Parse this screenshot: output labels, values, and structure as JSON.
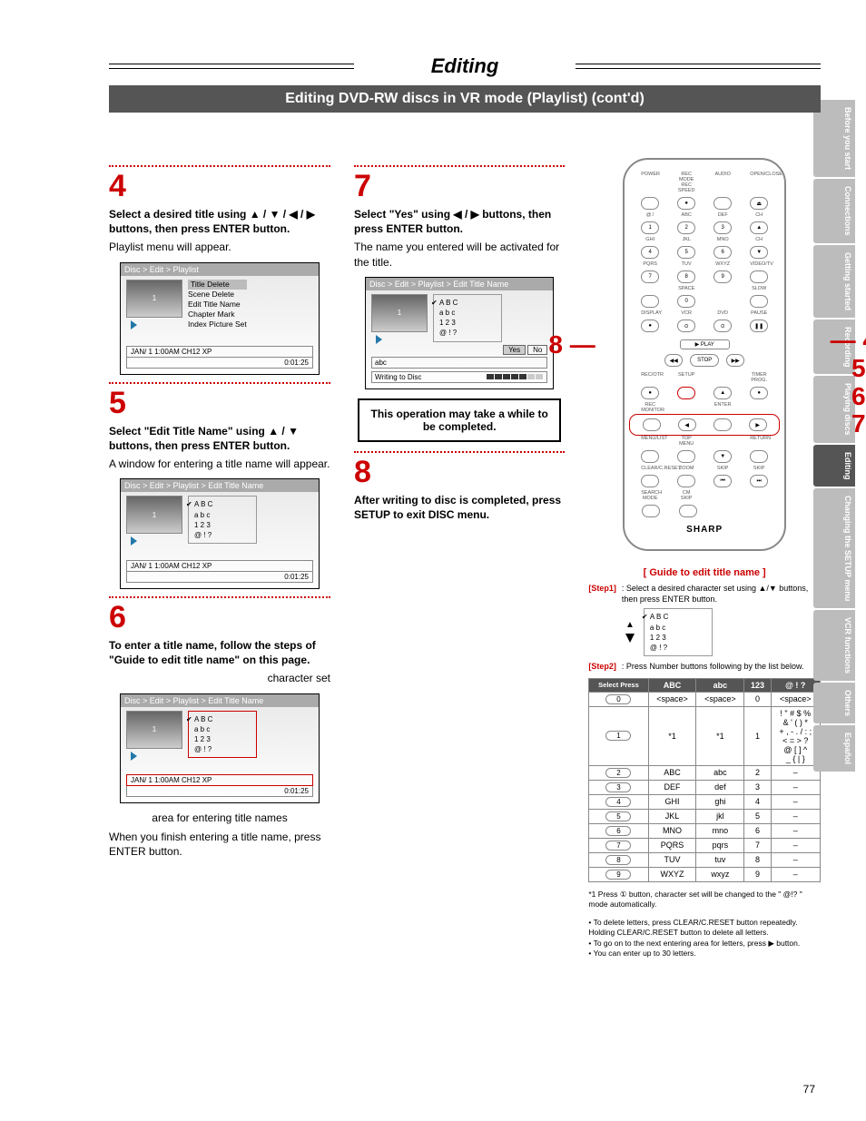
{
  "header": {
    "title": "Editing",
    "subtitle": "Editing DVD-RW discs in VR mode (Playlist) (cont'd)"
  },
  "steps": {
    "s4": {
      "num": "4",
      "head": "Select a desired title using ▲ / ▼ / ◀ / ▶ buttons, then press ENTER button.",
      "body": "Playlist menu will appear.",
      "breadcrumb": "Disc > Edit > Playlist",
      "menu": {
        "hl": "Title Delete",
        "items": [
          "Scene Delete",
          "Edit Title Name",
          "Chapter Mark",
          "Index Picture Set"
        ]
      },
      "status_left": "JAN/ 1   1:00AM  CH12     XP",
      "status_right": "0:01:25"
    },
    "s5": {
      "num": "5",
      "head": "Select \"Edit Title Name\" using ▲ / ▼ buttons, then press ENTER button.",
      "body": "A window for entering a title name will appear.",
      "breadcrumb": "Disc > Edit > Playlist > Edit Title Name",
      "charset": {
        "sel": "A B C",
        "rows": [
          "a b c",
          "1 2 3",
          "@ ! ?"
        ]
      },
      "status_left": "JAN/ 1   1:00AM  CH12  XP",
      "status_right": "0:01:25"
    },
    "s6": {
      "num": "6",
      "head": "To enter a title name, follow the steps of \"Guide to edit title name\" on this page.",
      "label_top": "character set",
      "breadcrumb": "Disc > Edit  > Playlist > Edit Title Name",
      "charset": {
        "sel": "A B C",
        "rows": [
          "a b c",
          "1 2 3",
          "@ ! ?"
        ]
      },
      "label_bottom": "area for entering title names",
      "status_left": "JAN/ 1   1:00AM  CH12  XP",
      "status_right": "0:01:25",
      "after": "When you finish entering a title name, press ENTER button."
    },
    "s7": {
      "num": "7",
      "head": "Select \"Yes\" using ◀ / ▶ buttons, then press ENTER button.",
      "body": "The name you entered will be activated for the title.",
      "breadcrumb": "Disc > Edit > Playlist > Edit Title Name",
      "charset": {
        "sel": "A B C",
        "rows": [
          "a b c",
          "1 2 3",
          "@ ! ?"
        ]
      },
      "yes": "Yes",
      "no": "No",
      "abc_field": "abc",
      "write_label": "Writing to Disc",
      "callout": "This operation may take a while to be completed."
    },
    "s8": {
      "num": "8",
      "head": "After writing to disc is completed, press SETUP to exit DISC menu."
    }
  },
  "remote": {
    "row1": [
      "POWER",
      "REC MODE REC SPEED",
      "AUDIO",
      "OPEN/CLOSE"
    ],
    "row2_lbl": [
      "@.!",
      "ABC",
      "DEF",
      "CH"
    ],
    "row2_btn": [
      "1",
      "2",
      "3",
      "▲"
    ],
    "row3_lbl": [
      "GHI",
      "JKL",
      "MNO",
      "CH"
    ],
    "row3_btn": [
      "4",
      "5",
      "6",
      "▼"
    ],
    "row4_lbl": [
      "PQRS",
      "TUV",
      "WXYZ",
      "VIDEO/TV"
    ],
    "row4_btn": [
      "7",
      "8",
      "9",
      ""
    ],
    "row5_lbl": [
      "",
      "SPACE",
      "",
      "SLOW"
    ],
    "row5_btn": [
      "",
      "0",
      "",
      ""
    ],
    "row6_lbl": [
      "DISPLAY",
      "VCR",
      "DVD",
      "PAUSE"
    ],
    "play": "PLAY",
    "stop": "STOP",
    "row8_lbl": [
      "REC/OTR",
      "SETUP",
      "",
      "TIMER PROG."
    ],
    "row9_lbl": [
      "REC MONITOR",
      "",
      "ENTER",
      ""
    ],
    "row10_lbl": [
      "MENU/LIST",
      "TOP MENU",
      "",
      "RETURN"
    ],
    "row11_lbl": [
      "CLEAR/C.RESET",
      "ZOOM",
      "SKIP",
      "SKIP"
    ],
    "row12_lbl": [
      "SEARCH MODE",
      "CM SKIP",
      "",
      ""
    ],
    "brand": "SHARP",
    "c_left": "8",
    "c_right": [
      "4",
      "5",
      "6",
      "7"
    ]
  },
  "guide": {
    "title": "[ Guide to edit title name ]",
    "step1_tag": "[Step1]",
    "step1_body": ": Select a desired character set using ▲/▼ buttons, then press ENTER button.",
    "step1_charset": {
      "sel": "A B C",
      "rows": [
        "a b c",
        "1 2 3",
        "@ ! ?"
      ]
    },
    "step2_tag": "[Step2]",
    "step2_body": ": Press Number buttons following by the list below.",
    "table": {
      "corner": "Select Press",
      "headers": [
        "ABC",
        "abc",
        "123",
        "@ ! ?"
      ],
      "rows": [
        {
          "btn": "0",
          "cells": [
            "<space>",
            "<space>",
            "0",
            "<space>"
          ]
        },
        {
          "btn": "1",
          "cells": [
            "*1",
            "*1",
            "1",
            "! \" # $ %\n& ' ( ) *\n+ , - . / : ;\n< = > ?\n@ [ ] ^\n_ { | }"
          ]
        },
        {
          "btn": "2",
          "cells": [
            "ABC",
            "abc",
            "2",
            "–"
          ]
        },
        {
          "btn": "3",
          "cells": [
            "DEF",
            "def",
            "3",
            "–"
          ]
        },
        {
          "btn": "4",
          "cells": [
            "GHI",
            "ghi",
            "4",
            "–"
          ]
        },
        {
          "btn": "5",
          "cells": [
            "JKL",
            "jkl",
            "5",
            "–"
          ]
        },
        {
          "btn": "6",
          "cells": [
            "MNO",
            "mno",
            "6",
            "–"
          ]
        },
        {
          "btn": "7",
          "cells": [
            "PQRS",
            "pqrs",
            "7",
            "–"
          ]
        },
        {
          "btn": "8",
          "cells": [
            "TUV",
            "tuv",
            "8",
            "–"
          ]
        },
        {
          "btn": "9",
          "cells": [
            "WXYZ",
            "wxyz",
            "9",
            "–"
          ]
        }
      ]
    },
    "note_star": "*1  Press ① button, character set will be changed to the \" @!? \" mode automatically.",
    "bullets": [
      "To delete letters, press CLEAR/C.RESET button repeatedly. Holding CLEAR/C.RESET button to delete all letters.",
      "To go on to the next entering area for letters, press ▶ button.",
      "You can enter up to 30 letters."
    ]
  },
  "tabs": [
    "Before you start",
    "Connections",
    "Getting started",
    "Recording",
    "Playing discs",
    "Editing",
    "Changing the SETUP menu",
    "VCR functions",
    "Others",
    "Español"
  ],
  "active_tab": "Editing",
  "page_number": "77"
}
